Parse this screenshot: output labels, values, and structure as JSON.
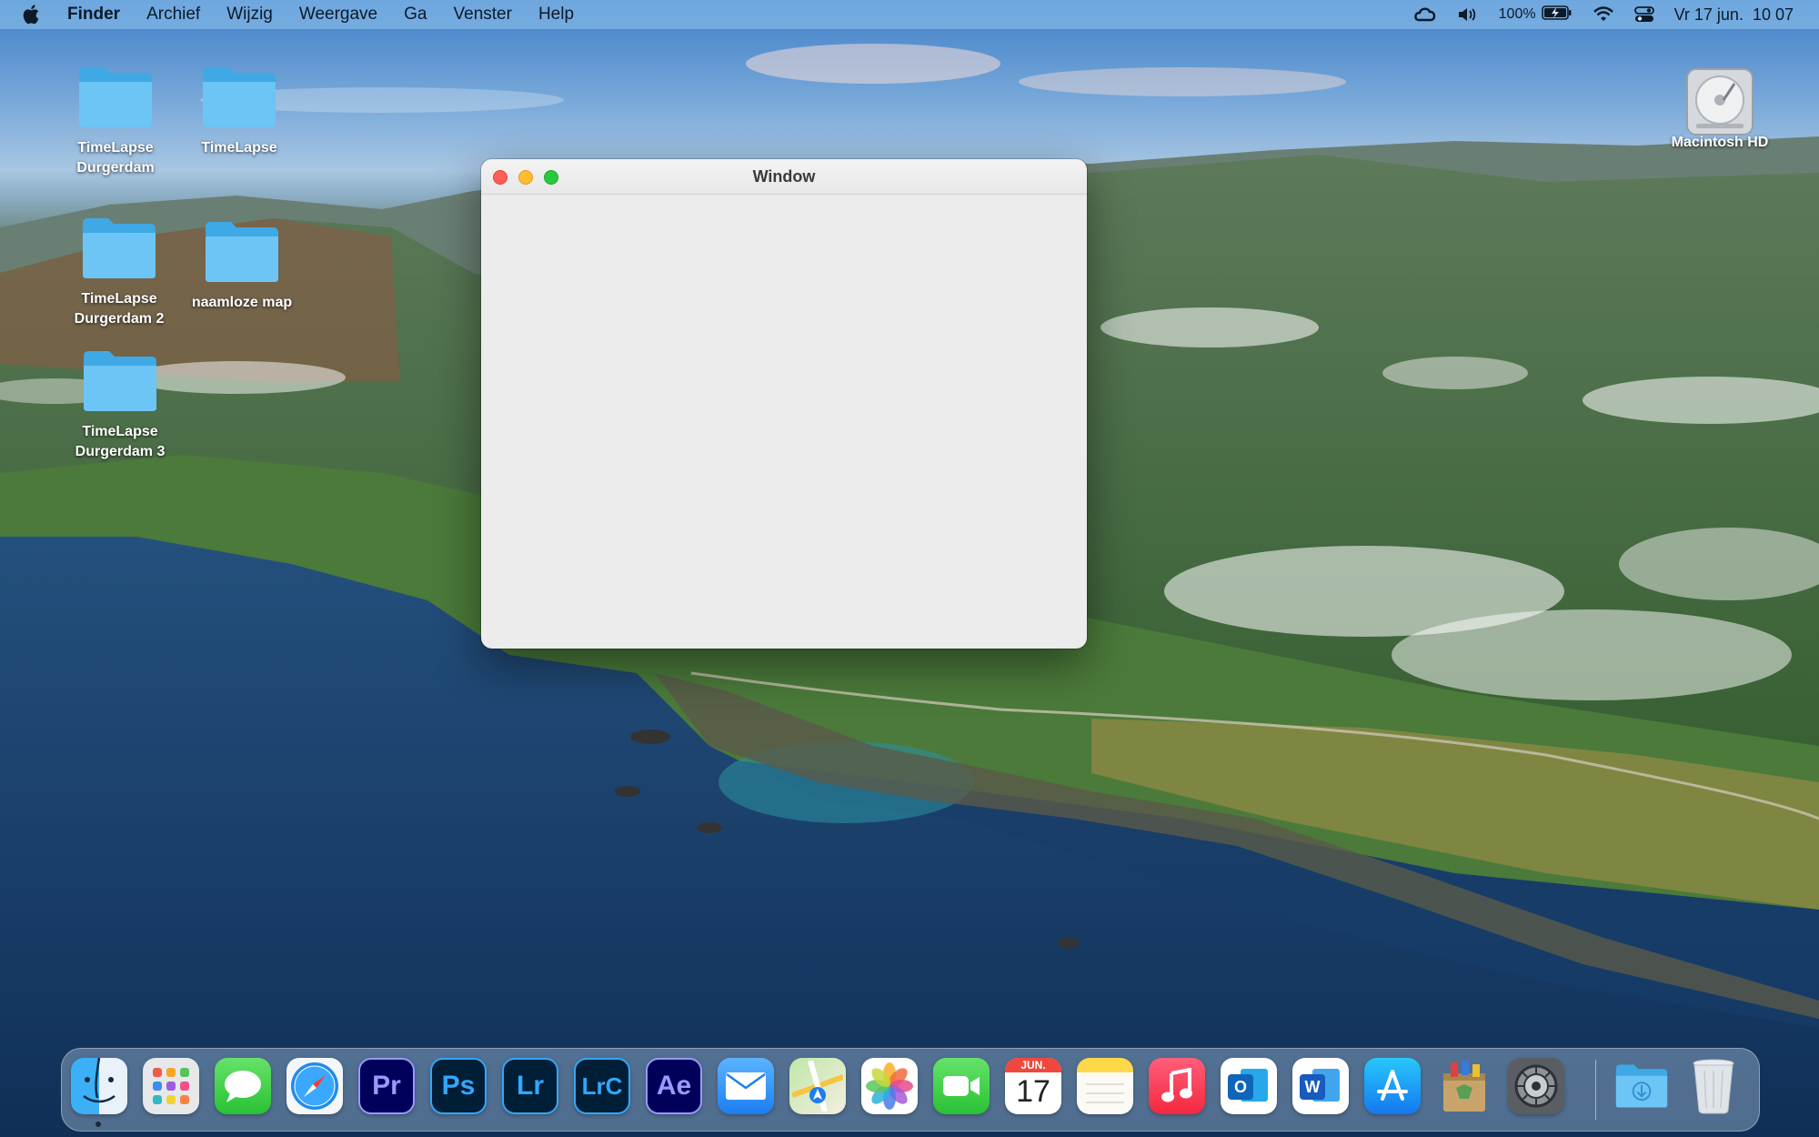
{
  "menubar": {
    "app_name": "Finder",
    "menus": [
      "Archief",
      "Wijzig",
      "Weergave",
      "Ga",
      "Venster",
      "Help"
    ],
    "battery_percent": "100%",
    "datetime": "Vr 17 jun.  10 07"
  },
  "desktop": {
    "icons": [
      {
        "label": "TimeLapse\nDurgerdam"
      },
      {
        "label": "TimeLapse"
      },
      {
        "label": "TimeLapse\nDurgerdam 2"
      },
      {
        "label": "naamloze map"
      },
      {
        "label": "TimeLapse\nDurgerdam 3"
      },
      {
        "label": "Macintosh HD"
      }
    ]
  },
  "window": {
    "title": "Window"
  },
  "dock": {
    "items": [
      {
        "name": "finder",
        "text": ""
      },
      {
        "name": "launchpad",
        "text": ""
      },
      {
        "name": "messages",
        "text": ""
      },
      {
        "name": "safari",
        "text": ""
      },
      {
        "name": "premiere-pro",
        "text": "Pr",
        "color": "#9999ff"
      },
      {
        "name": "photoshop",
        "text": "Ps",
        "color": "#31a8ff"
      },
      {
        "name": "lightroom",
        "text": "Lr",
        "color": "#31a8ff"
      },
      {
        "name": "lightroom-classic",
        "text": "LrC",
        "color": "#31a8ff"
      },
      {
        "name": "after-effects",
        "text": "Ae",
        "color": "#9999ff"
      },
      {
        "name": "mail",
        "text": ""
      },
      {
        "name": "maps",
        "text": ""
      },
      {
        "name": "photos",
        "text": ""
      },
      {
        "name": "facetime",
        "text": ""
      },
      {
        "name": "calendar",
        "text": "17",
        "month": "JUN."
      },
      {
        "name": "notes",
        "text": ""
      },
      {
        "name": "music",
        "text": ""
      },
      {
        "name": "outlook",
        "text": "O"
      },
      {
        "name": "word",
        "text": "W"
      },
      {
        "name": "app-store",
        "text": ""
      },
      {
        "name": "archive-utility",
        "text": ""
      },
      {
        "name": "system-preferences",
        "text": ""
      },
      {
        "name": "downloads",
        "text": ""
      },
      {
        "name": "trash",
        "text": ""
      }
    ]
  }
}
